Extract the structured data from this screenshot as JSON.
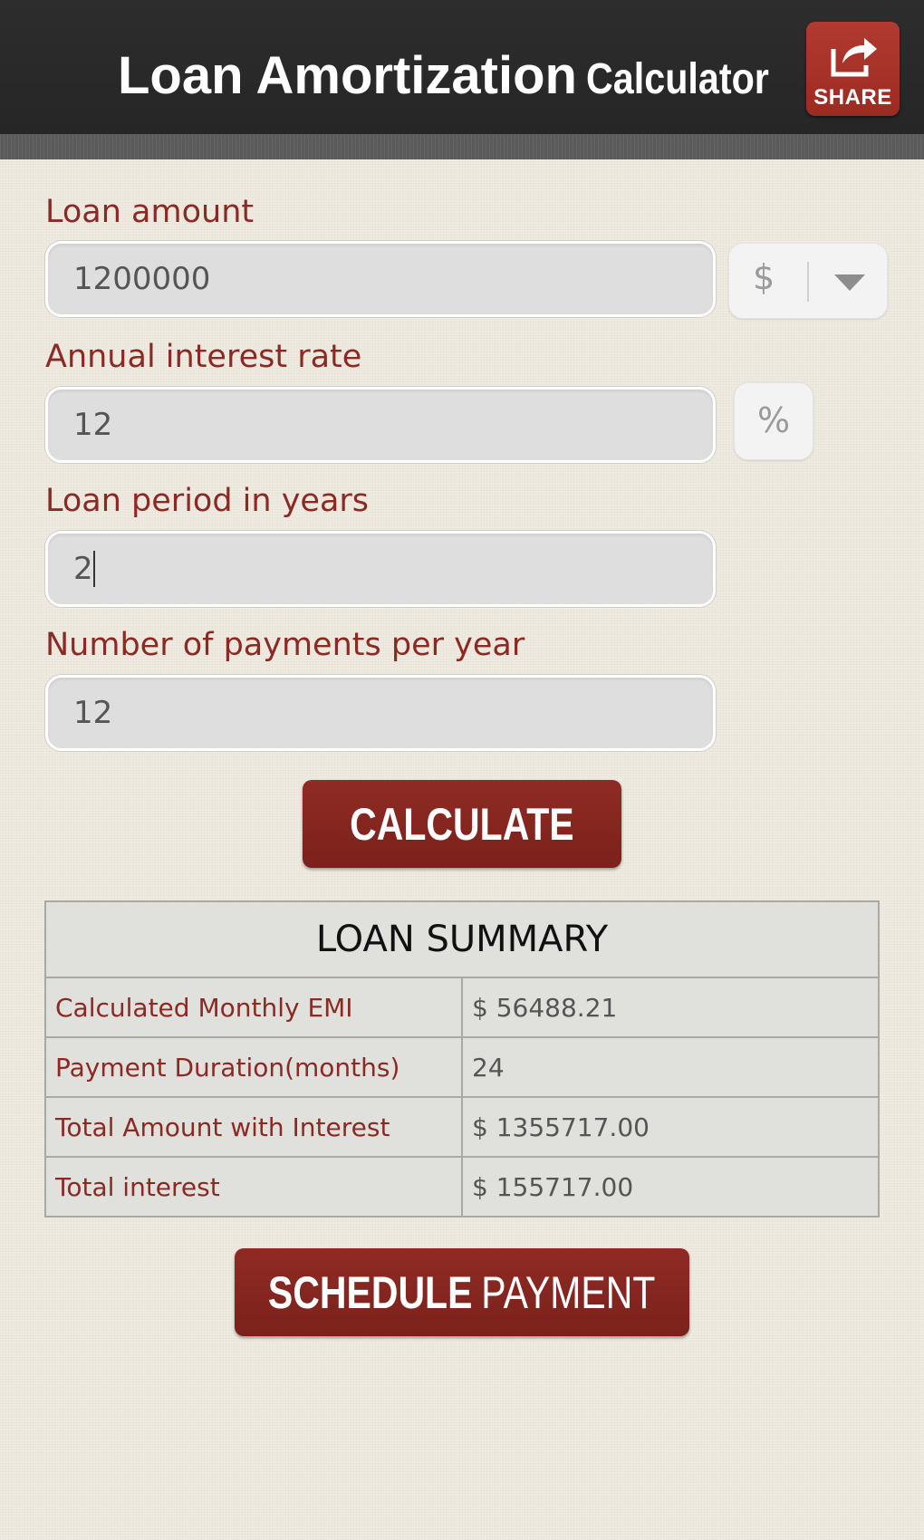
{
  "header": {
    "title_main": "Loan Amortization",
    "title_sub": "Calculator",
    "share_label": "SHARE"
  },
  "form": {
    "loan_amount": {
      "label": "Loan amount",
      "value": "1200000",
      "currency": "$"
    },
    "interest_rate": {
      "label": "Annual interest rate",
      "value": "12",
      "unit": "%"
    },
    "loan_period": {
      "label": "Loan period in years",
      "value": "2"
    },
    "payments_per_year": {
      "label": "Number of payments per year",
      "value": "12"
    }
  },
  "calculate_label": "CALCULATE",
  "summary": {
    "title": "LOAN SUMMARY",
    "rows": [
      {
        "label": "Calculated Monthly EMI",
        "value": "$ 56488.21"
      },
      {
        "label": "Payment Duration(months)",
        "value": "24"
      },
      {
        "label": "Total Amount with Interest",
        "value": "$ 1355717.00"
      },
      {
        "label": "Total interest",
        "value": "$ 155717.00"
      }
    ]
  },
  "schedule": {
    "label_bold": "SCHEDULE",
    "label_regular": "PAYMENT"
  },
  "colors": {
    "header_bg": "#2d2d2d",
    "accent_red": "#8b2a22",
    "button_red": "#7b211b",
    "share_red": "#b23a30",
    "page_bg": "#f0ebe1",
    "input_bg": "#dedede"
  },
  "icons": {
    "share": "share-arrow-icon",
    "dropdown": "chevron-down-icon"
  }
}
